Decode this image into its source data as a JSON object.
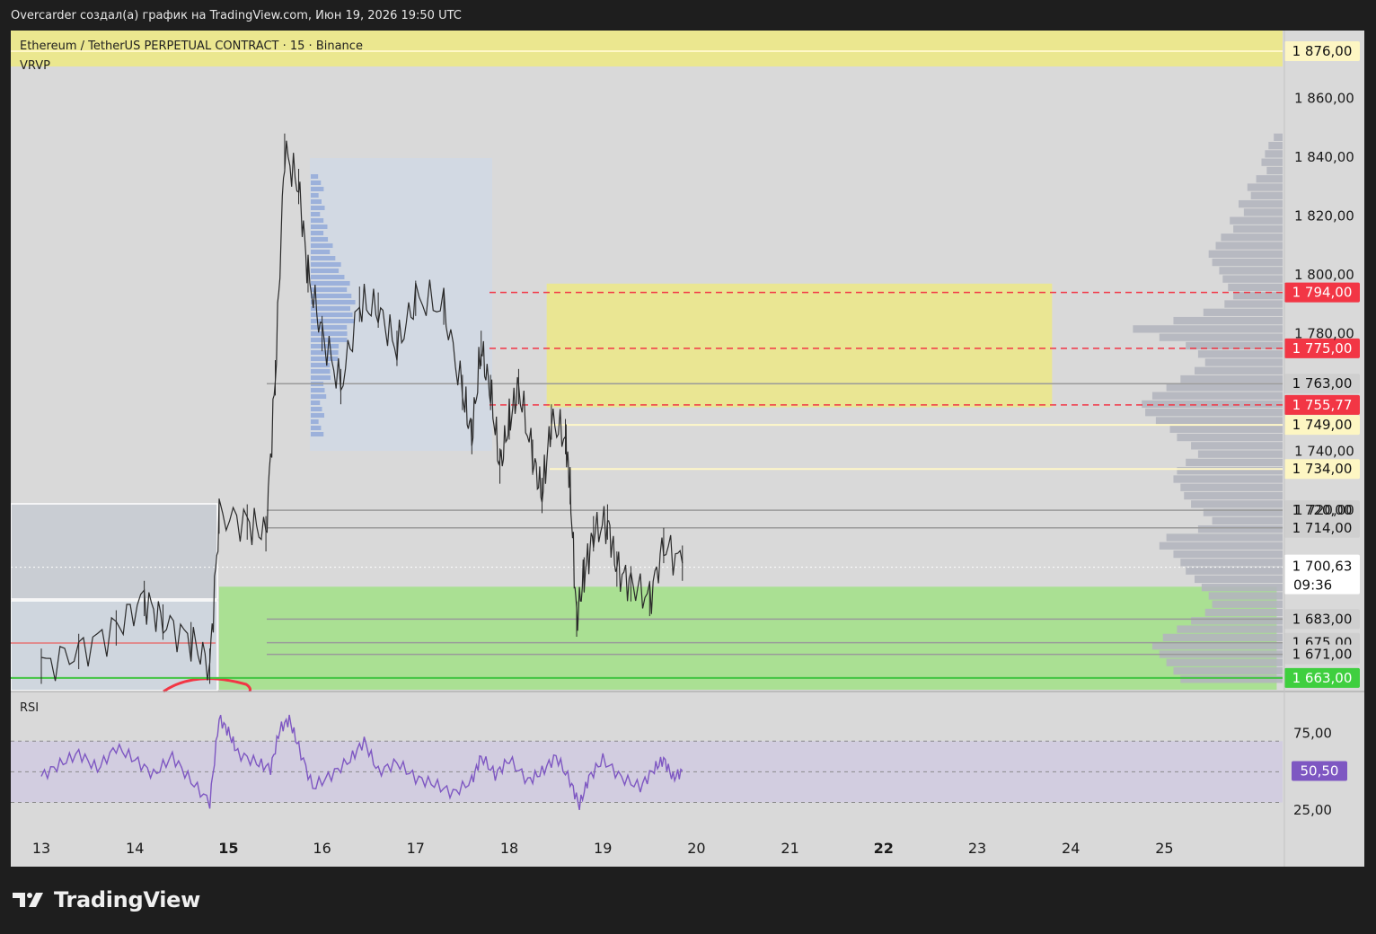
{
  "header": {
    "caption": "Overcarder создал(а) график на TradingView.com, Июн 19, 2026 19:50 UTC"
  },
  "chart": {
    "symbol_line": "Ethereum / TetherUS PERPETUAL CONTRACT · 15 · Binance",
    "indicator": "VRVP",
    "rsi_label": "RSI",
    "countdown": "09:36"
  },
  "brand": {
    "name": "TradingView"
  },
  "colors": {
    "yellow_zone": "#ebe78f",
    "green_zone": "#a8e08f",
    "red_level": "#f23645",
    "rsi_line": "#7e57c2",
    "rsi_badge": "#7e57c2",
    "volume_profile": "#b2b5be",
    "up_candle": "#26a69a",
    "down_candle": "#ef5350"
  },
  "chart_data": {
    "type": "candlestick",
    "price_axis": {
      "ticks": [
        "1 860,00",
        "1 840,00",
        "1 820,00",
        "1 800,00",
        "1 780,00",
        "1 740,00",
        "1 720,00"
      ],
      "tick_values": [
        1860,
        1840,
        1820,
        1800,
        1780,
        1740,
        1720
      ],
      "range": [
        1659,
        1883
      ]
    },
    "time_axis": {
      "labels": [
        "13",
        "14",
        "15",
        "16",
        "17",
        "18",
        "19",
        "20",
        "21",
        "22",
        "23",
        "24",
        "25"
      ],
      "bold": [
        false,
        false,
        true,
        false,
        false,
        false,
        false,
        false,
        false,
        true,
        false,
        false,
        false
      ]
    },
    "last_price": {
      "label": "1 700,63",
      "value": 1700.63
    },
    "price_path": [
      [
        13.0,
        1667
      ],
      [
        13.4,
        1672
      ],
      [
        13.8,
        1680
      ],
      [
        14.1,
        1690
      ],
      [
        14.3,
        1682
      ],
      [
        14.6,
        1676
      ],
      [
        14.8,
        1667
      ],
      [
        14.9,
        1718
      ],
      [
        15.2,
        1716
      ],
      [
        15.4,
        1712
      ],
      [
        15.5,
        1765
      ],
      [
        15.6,
        1842
      ],
      [
        15.75,
        1830
      ],
      [
        15.85,
        1800
      ],
      [
        16.0,
        1780
      ],
      [
        16.2,
        1762
      ],
      [
        16.4,
        1790
      ],
      [
        16.6,
        1788
      ],
      [
        16.8,
        1775
      ],
      [
        17.0,
        1792
      ],
      [
        17.3,
        1789
      ],
      [
        17.5,
        1760
      ],
      [
        17.6,
        1745
      ],
      [
        17.7,
        1775
      ],
      [
        17.8,
        1760
      ],
      [
        17.9,
        1735
      ],
      [
        18.0,
        1750
      ],
      [
        18.1,
        1762
      ],
      [
        18.25,
        1738
      ],
      [
        18.35,
        1725
      ],
      [
        18.45,
        1750
      ],
      [
        18.6,
        1745
      ],
      [
        18.65,
        1728
      ],
      [
        18.72,
        1683
      ],
      [
        18.8,
        1698
      ],
      [
        18.9,
        1712
      ],
      [
        19.05,
        1716
      ],
      [
        19.15,
        1700
      ],
      [
        19.3,
        1695
      ],
      [
        19.5,
        1690
      ],
      [
        19.65,
        1708
      ],
      [
        19.85,
        1702
      ]
    ],
    "levels": [
      {
        "price": 1876,
        "label": "1 876,00",
        "style": "yellow"
      },
      {
        "price": 1794,
        "label": "1 794,00",
        "style": "red"
      },
      {
        "price": 1775,
        "label": "1 775,00",
        "style": "red"
      },
      {
        "price": 1763,
        "label": "1 763,00",
        "style": "gray"
      },
      {
        "price": 1755.77,
        "label": "1 755,77",
        "style": "red"
      },
      {
        "price": 1749,
        "label": "1 749,00",
        "style": "yellow"
      },
      {
        "price": 1734,
        "label": "1 734,00",
        "style": "yellow"
      },
      {
        "price": 1720,
        "label": "1 720,00",
        "style": "gray"
      },
      {
        "price": 1714,
        "label": "1 714,00",
        "style": "gray"
      },
      {
        "price": 1683,
        "label": "1 683,00",
        "style": "gray"
      },
      {
        "price": 1675,
        "label": "1 675,00",
        "style": "gray"
      },
      {
        "price": 1671,
        "label": "1 671,00",
        "style": "gray"
      },
      {
        "price": 1663,
        "label": "1 663,00",
        "style": "green"
      }
    ],
    "zones": [
      {
        "name": "yellow-zone",
        "t_start": 18.4,
        "t_end": 23.8,
        "price_top": 1797,
        "price_bottom": 1755
      },
      {
        "name": "green-zone",
        "t_start": 14.9,
        "t_end": 26.2,
        "price_top": 1694,
        "price_bottom": 1659
      }
    ],
    "volume_profile": {
      "price_top": 1848,
      "price_bottom": 1661,
      "rows": [
        0.05,
        0.08,
        0.1,
        0.12,
        0.09,
        0.15,
        0.2,
        0.18,
        0.25,
        0.22,
        0.3,
        0.28,
        0.35,
        0.38,
        0.42,
        0.4,
        0.36,
        0.34,
        0.31,
        0.28,
        0.33,
        0.45,
        0.62,
        0.85,
        0.7,
        0.55,
        0.48,
        0.44,
        0.5,
        0.58,
        0.66,
        0.74,
        0.8,
        0.78,
        0.72,
        0.64,
        0.6,
        0.52,
        0.48,
        0.55,
        0.6,
        0.62,
        0.58,
        0.56,
        0.52,
        0.45,
        0.4,
        0.48,
        0.66,
        0.7,
        0.62,
        0.58,
        0.55,
        0.5,
        0.46,
        0.42,
        0.4,
        0.44,
        0.52,
        0.6,
        0.68,
        0.74,
        0.7,
        0.66,
        0.62,
        0.58
      ]
    },
    "rsi": {
      "ticks": [
        "75,00",
        "25,00"
      ],
      "tick_values": [
        75,
        25
      ],
      "range": [
        18,
        100
      ],
      "bands": [
        70,
        50,
        30
      ],
      "current": {
        "label": "50,50",
        "value": 50.5
      },
      "path": [
        [
          13.0,
          47
        ],
        [
          13.2,
          55
        ],
        [
          13.4,
          62
        ],
        [
          13.6,
          52
        ],
        [
          13.8,
          66
        ],
        [
          14.0,
          58
        ],
        [
          14.2,
          48
        ],
        [
          14.4,
          60
        ],
        [
          14.6,
          44
        ],
        [
          14.8,
          30
        ],
        [
          14.9,
          85
        ],
        [
          15.0,
          76
        ],
        [
          15.1,
          62
        ],
        [
          15.3,
          56
        ],
        [
          15.45,
          52
        ],
        [
          15.55,
          78
        ],
        [
          15.65,
          84
        ],
        [
          15.75,
          66
        ],
        [
          15.9,
          40
        ],
        [
          16.1,
          48
        ],
        [
          16.3,
          58
        ],
        [
          16.45,
          70
        ],
        [
          16.6,
          50
        ],
        [
          16.8,
          56
        ],
        [
          17.0,
          46
        ],
        [
          17.2,
          42
        ],
        [
          17.4,
          36
        ],
        [
          17.6,
          44
        ],
        [
          17.7,
          60
        ],
        [
          17.85,
          48
        ],
        [
          18.0,
          58
        ],
        [
          18.2,
          44
        ],
        [
          18.35,
          50
        ],
        [
          18.5,
          60
        ],
        [
          18.65,
          44
        ],
        [
          18.75,
          28
        ],
        [
          18.85,
          46
        ],
        [
          19.0,
          58
        ],
        [
          19.2,
          46
        ],
        [
          19.4,
          40
        ],
        [
          19.55,
          52
        ],
        [
          19.65,
          58
        ],
        [
          19.75,
          46
        ],
        [
          19.85,
          50.5
        ]
      ]
    }
  }
}
